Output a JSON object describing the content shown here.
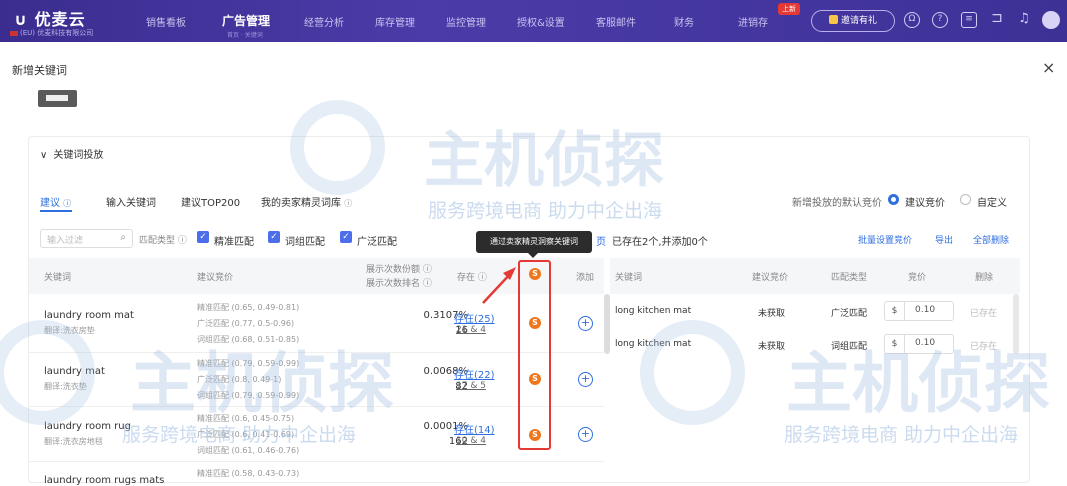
{
  "topbar": {
    "logo": "优麦云",
    "logo_sub": "(EU) 优麦科技有限公司",
    "nav": [
      "销售看板",
      "广告管理",
      "经营分析",
      "库存管理",
      "监控管理",
      "授权&设置",
      "客服邮件",
      "财务",
      "进销存"
    ],
    "nav_active_sub": "首页 · 关键词",
    "new_badge": "上新",
    "invite": "邀请有礼",
    "accent": "#3a2d8f"
  },
  "dialog": {
    "title": "新增关键词",
    "close": "×"
  },
  "section": {
    "title": "关键词投放",
    "chevron": "∨"
  },
  "tabs": [
    "建议",
    "输入关键词",
    "建议TOP200",
    "我的卖家精灵词库"
  ],
  "bid_default": {
    "label": "新增投放的默认竞价",
    "opt1": "建议竞价",
    "opt2": "自定义"
  },
  "filter": {
    "placeholder": "输入过滤",
    "match_label": "匹配类型",
    "checks": [
      "精准匹配",
      "词组匹配",
      "广泛匹配"
    ]
  },
  "tooltip": "通过卖家精灵洞察关键词",
  "status": {
    "text": "已存在2个,并添加0个",
    "left_tail": "页"
  },
  "actions": [
    "批量设置竞价",
    "导出",
    "全部删除"
  ],
  "left_headers": {
    "kw": "关键词",
    "bid": "建议竞价",
    "share1": "展示次数份额",
    "share2": "展示次数排名",
    "exist": "存在",
    "add": "添加"
  },
  "rows": [
    {
      "kw": "laundry room mat",
      "tr": "翻译:洗衣房垫",
      "b1": "精准匹配 (0.65, 0.49-0.81)",
      "b2": "广泛匹配 (0.77, 0.5-0.96)",
      "b3": "词组匹配 (0.68, 0.51-0.85)",
      "pct": "0.3107%",
      "rank": "16",
      "exist": "存在(25)",
      "nums": "21 & 4"
    },
    {
      "kw": "laundry mat",
      "tr": "翻译:洗衣垫",
      "b1": "精准匹配 (0.79, 0.59-0.99)",
      "b2": "广泛匹配 (0.8, 0.49-1)",
      "b3": "词组匹配 (0.79, 0.59-0.99)",
      "pct": "0.0068%",
      "rank": "82",
      "exist": "存在(22)",
      "nums": "17 & 5"
    },
    {
      "kw": "laundry room rug",
      "tr": "翻译:洗衣房地毯",
      "b1": "精准匹配 (0.6, 0.45-0.75)",
      "b2": "广泛匹配 (0.6, 0.41-0.69)",
      "b3": "词组匹配 (0.61, 0.46-0.76)",
      "pct": "0.0001%",
      "rank": "162",
      "exist": "存在(14)",
      "nums": "10 & 4"
    },
    {
      "kw": "laundry room rugs mats",
      "b1": "精准匹配 (0.58, 0.43-0.73)"
    }
  ],
  "right_headers": {
    "kw": "关键词",
    "bid": "建议竞价",
    "type": "匹配类型",
    "price": "竞价",
    "del": "删除"
  },
  "right_rows": [
    {
      "kw": "long kitchen mat",
      "bid": "未获取",
      "type": "广泛匹配",
      "cur": "$",
      "price": "0.10",
      "status": "已存在"
    },
    {
      "kw": "long kitchen mat",
      "bid": "未获取",
      "type": "词组匹配",
      "cur": "$",
      "price": "0.10",
      "status": "已存在"
    }
  ],
  "watermark": {
    "big": "主机侦探",
    "small": "服务跨境电商 助力中企出海"
  },
  "colors": {
    "link": "#2f6fe0",
    "sprite": "#f0761d",
    "highlight": "#e53935"
  }
}
